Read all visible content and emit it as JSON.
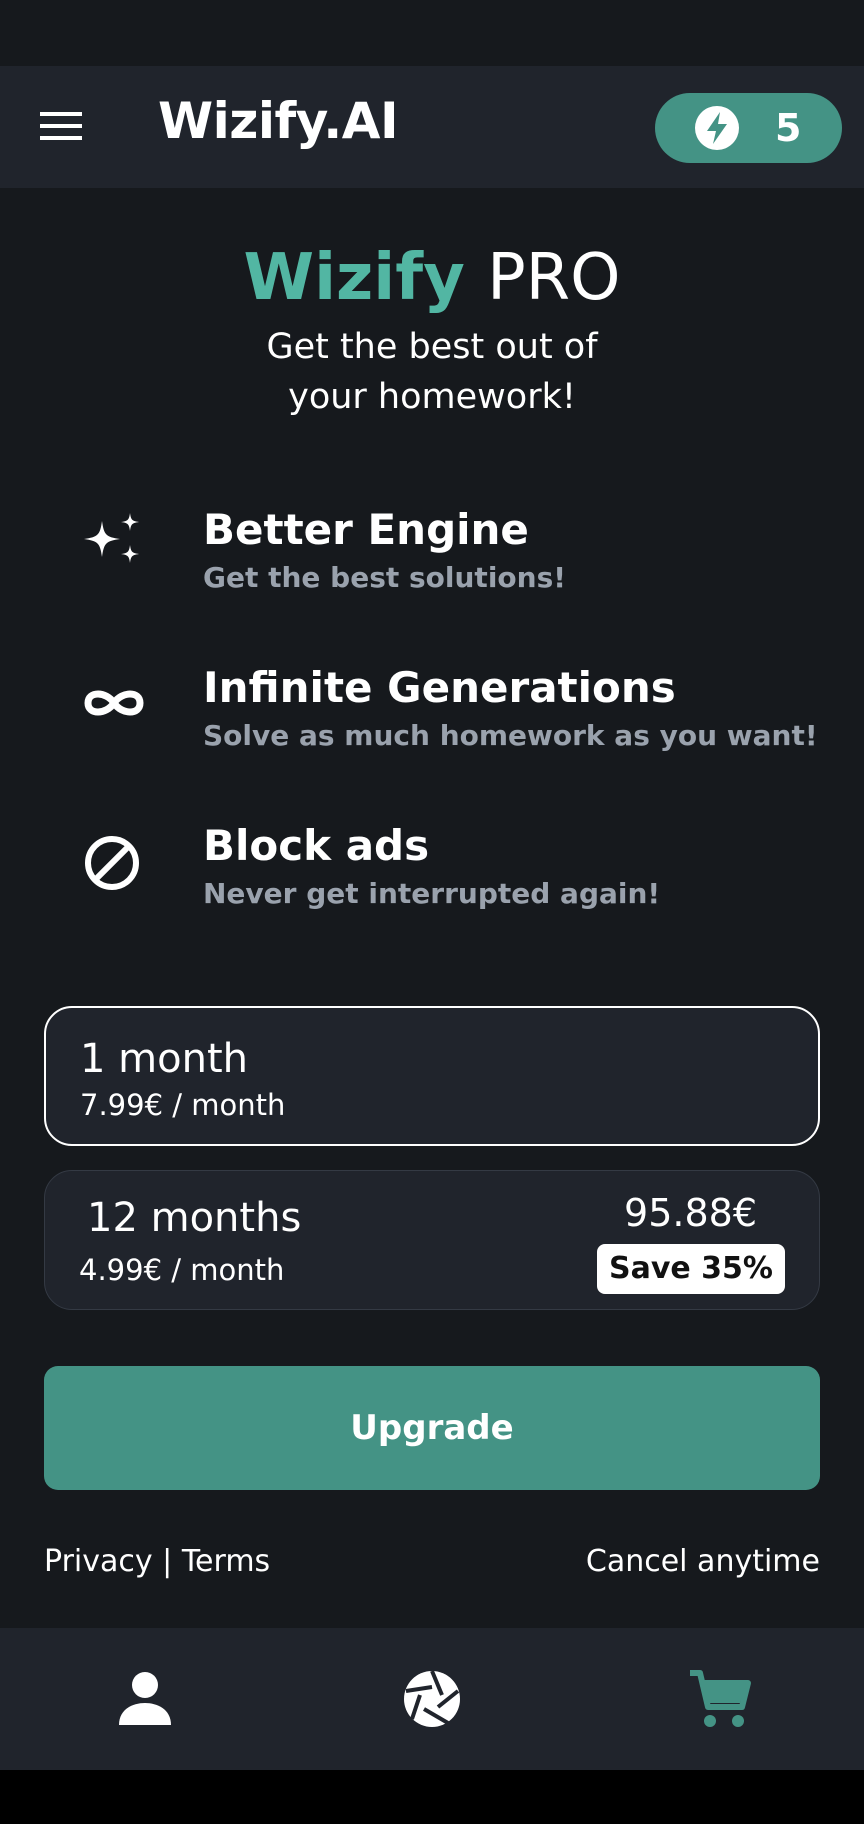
{
  "app_bar": {
    "title": "Wizify.AI",
    "menu_icon": "hamburger-menu-icon",
    "credits": {
      "icon": "lightning-bolt-icon",
      "count": "5"
    }
  },
  "hero": {
    "brand": "Wizify",
    "tier": "PRO",
    "subtitle_line1": "Get the best out of",
    "subtitle_line2": "your homework!"
  },
  "features": [
    {
      "icon": "sparkles-icon",
      "title": "Better Engine",
      "description": "Get the best solutions!"
    },
    {
      "icon": "infinity-icon",
      "title": "Infinite Generations",
      "description": "Solve as much homework as you want!"
    },
    {
      "icon": "block-icon",
      "title": "Block ads",
      "description": "Never get interrupted again!"
    }
  ],
  "plans": [
    {
      "name": "1 month",
      "price": "7.99€ / month",
      "selected": true
    },
    {
      "name": "12 months",
      "price": "4.99€ / month",
      "total": "95.88€",
      "badge": "Save 35%",
      "selected": false
    }
  ],
  "upgrade_label": "Upgrade",
  "footer": {
    "privacy": "Privacy",
    "separator": "|",
    "terms": "Terms",
    "cancel": "Cancel anytime"
  },
  "bottom_nav": [
    {
      "icon": "person-icon",
      "active": false
    },
    {
      "icon": "camera-shutter-icon",
      "active": false
    },
    {
      "icon": "cart-icon",
      "active": true
    }
  ],
  "colors": {
    "background": "#16191d",
    "surface": "#20242c",
    "accent": "#449385",
    "brand_text": "#52b6a3",
    "muted_text": "#9aa2ad"
  }
}
